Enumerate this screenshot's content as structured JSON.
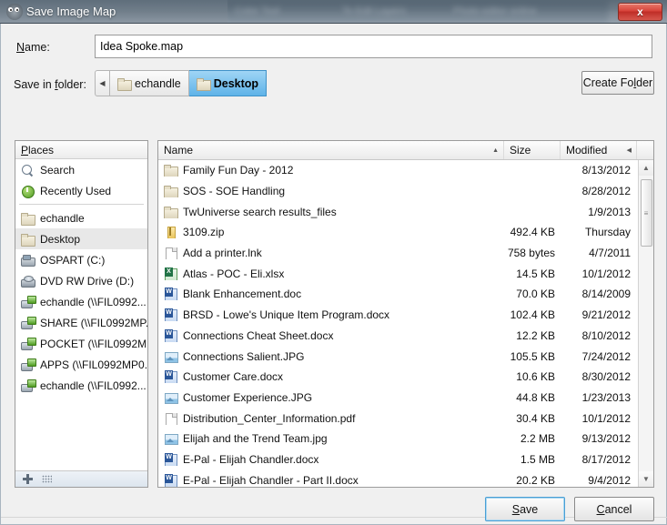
{
  "window": {
    "title": "Save Image Map",
    "icon": "wilber-icon",
    "close_label": "x",
    "background_ghost_texts": [
      "Color Tool",
      "To Edit Layers",
      "Photo editor online"
    ]
  },
  "name_field": {
    "label": "Name:",
    "label_mnemonic": "N",
    "value": "Idea Spoke.map"
  },
  "folder_row": {
    "label": "Save in folder:",
    "label_mnemonic": "f",
    "back_arrow": "◀",
    "crumbs": [
      {
        "label": "echandle",
        "active": false
      },
      {
        "label": "Desktop",
        "active": true
      }
    ],
    "create_folder_label": "Create Folder",
    "create_folder_mnemonic": "l"
  },
  "places": {
    "header": "Places",
    "header_mnemonic": "P",
    "items": [
      {
        "label": "Search",
        "icon": "search-icon",
        "selected": false
      },
      {
        "label": "Recently Used",
        "icon": "recent-icon",
        "selected": false
      },
      {
        "label": "echandle",
        "icon": "folder-icon",
        "selected": false,
        "sep_before": true
      },
      {
        "label": "Desktop",
        "icon": "folder-icon",
        "selected": true
      },
      {
        "label": "OSPART (C:)",
        "icon": "drive-icon",
        "selected": false
      },
      {
        "label": "DVD RW Drive (D:)",
        "icon": "dvd-drive-icon",
        "selected": false
      },
      {
        "label": "echandle (\\\\FIL0992...",
        "icon": "network-drive-icon",
        "selected": false
      },
      {
        "label": "SHARE (\\\\FIL0992MP...",
        "icon": "network-drive-icon",
        "selected": false
      },
      {
        "label": "POCKET (\\\\FIL0992M...",
        "icon": "network-drive-icon",
        "selected": false
      },
      {
        "label": "APPS (\\\\FIL0992MP0...",
        "icon": "network-drive-icon",
        "selected": false
      },
      {
        "label": "echandle (\\\\FIL0992...",
        "icon": "network-drive-icon",
        "selected": false
      }
    ]
  },
  "files": {
    "columns": [
      {
        "key": "name",
        "label": "Name",
        "sort": "asc"
      },
      {
        "key": "size",
        "label": "Size",
        "sort": "none"
      },
      {
        "key": "modified",
        "label": "Modified",
        "sort": "left"
      }
    ],
    "sort_asc_glyph": "▲",
    "sort_left_glyph": "◀",
    "rows": [
      {
        "name": "Family Fun Day - 2012",
        "size": "",
        "modified": "8/13/2012",
        "icon": "folder-icon"
      },
      {
        "name": "SOS - SOE Handling",
        "size": "",
        "modified": "8/28/2012",
        "icon": "folder-icon"
      },
      {
        "name": "TwUniverse  search results_files",
        "size": "",
        "modified": "1/9/2013",
        "icon": "folder-icon"
      },
      {
        "name": "3109.zip",
        "size": "492.4 KB",
        "modified": "Thursday",
        "icon": "zip-icon"
      },
      {
        "name": "Add a printer.lnk",
        "size": "758 bytes",
        "modified": "4/7/2011",
        "icon": "blank-document-icon"
      },
      {
        "name": "Atlas - POC - Eli.xlsx",
        "size": "14.5 KB",
        "modified": "10/1/2012",
        "icon": "excel-document-icon"
      },
      {
        "name": "Blank Enhancement.doc",
        "size": "70.0 KB",
        "modified": "8/14/2009",
        "icon": "word-document-icon"
      },
      {
        "name": "BRSD - Lowe's Unique Item Program.docx",
        "size": "102.4 KB",
        "modified": "9/21/2012",
        "icon": "word-document-icon"
      },
      {
        "name": "Connections Cheat Sheet.docx",
        "size": "12.2 KB",
        "modified": "8/10/2012",
        "icon": "word-document-icon"
      },
      {
        "name": "Connections Salient.JPG",
        "size": "105.5 KB",
        "modified": "7/24/2012",
        "icon": "image-file-icon"
      },
      {
        "name": "Customer Care.docx",
        "size": "10.6 KB",
        "modified": "8/30/2012",
        "icon": "word-document-icon"
      },
      {
        "name": "Customer Experience.JPG",
        "size": "44.8 KB",
        "modified": "1/23/2013",
        "icon": "image-file-icon"
      },
      {
        "name": "Distribution_Center_Information.pdf",
        "size": "30.4 KB",
        "modified": "10/1/2012",
        "icon": "blank-document-icon"
      },
      {
        "name": "Elijah and the Trend Team.jpg",
        "size": "2.2 MB",
        "modified": "9/13/2012",
        "icon": "image-file-icon"
      },
      {
        "name": "E-Pal - Elijah Chandler.docx",
        "size": "1.5 MB",
        "modified": "8/17/2012",
        "icon": "word-document-icon"
      },
      {
        "name": "E-Pal - Elijah Chandler - Part II.docx",
        "size": "20.2 KB",
        "modified": "9/4/2012",
        "icon": "word-document-icon"
      }
    ],
    "scroll_up_glyph": "▲",
    "scroll_down_glyph": "▼",
    "thumb_grip": "≡"
  },
  "footer": {
    "save_label": "Save",
    "save_mnemonic": "S",
    "cancel_label": "Cancel",
    "cancel_mnemonic": "C"
  },
  "colors": {
    "accent_blue": "#5fb3e8",
    "close_red": "#d8433a",
    "dialog_bg": "#f0f0f0",
    "selection_gray": "#e8e8e8"
  }
}
